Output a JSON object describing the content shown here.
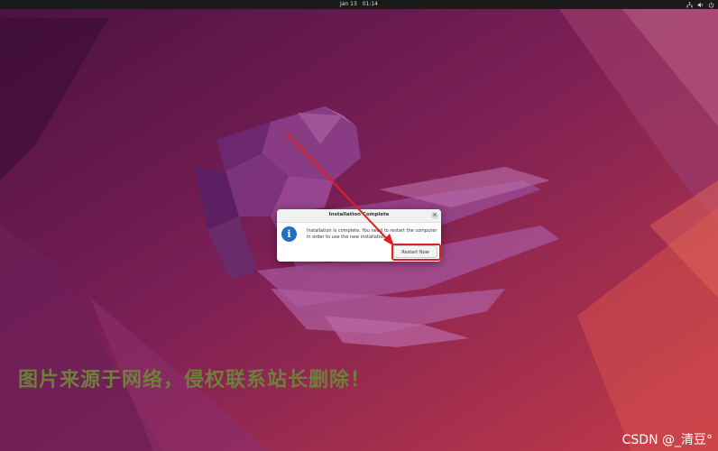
{
  "topbar": {
    "date": "Jan 13",
    "time": "01:14",
    "tray_icons": [
      "network-icon",
      "volume-icon",
      "power-icon"
    ]
  },
  "dialog": {
    "title": "Installation Complete",
    "message": "Installation is complete. You need to restart the computer in order to use the new installation.",
    "button_label": "Restart Now",
    "close_glyph": "×",
    "icon_glyph": "i"
  },
  "overlay": {
    "watermark": "图片来源于网络，侵权联系站长删除！",
    "credit": "CSDN @_清豆°"
  },
  "colors": {
    "topbar": "#1a1a1a",
    "info_icon": "#1f6fc2",
    "highlight": "#e02020",
    "watermark": "#6f7f3b"
  }
}
